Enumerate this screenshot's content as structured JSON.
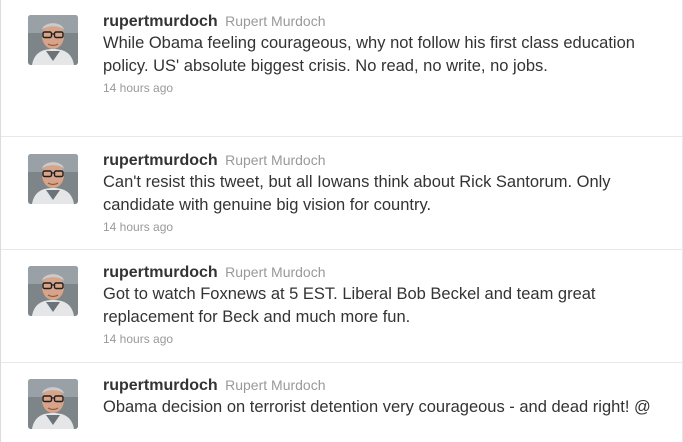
{
  "timeline": {
    "tweets": [
      {
        "screen_name": "rupertmurdoch",
        "full_name": "Rupert Murdoch",
        "text": "While Obama feeling courageous, why not follow his first class education policy. US' absolute biggest crisis. No read, no write, no jobs.",
        "timestamp": "14 hours ago"
      },
      {
        "screen_name": "rupertmurdoch",
        "full_name": "Rupert Murdoch",
        "text": "Can't resist this tweet, but all Iowans think about Rick Santorum. Only candidate with genuine big vision for country.",
        "timestamp": "14 hours ago"
      },
      {
        "screen_name": "rupertmurdoch",
        "full_name": "Rupert Murdoch",
        "text": "Got to watch Foxnews at 5 EST. Liberal Bob Beckel and team great replacement for Beck and much more fun.",
        "timestamp": "14 hours ago"
      },
      {
        "screen_name": "rupertmurdoch",
        "full_name": "Rupert Murdoch",
        "text": "Obama decision on terrorist detention very courageous - and dead right! @",
        "timestamp": ""
      }
    ]
  }
}
